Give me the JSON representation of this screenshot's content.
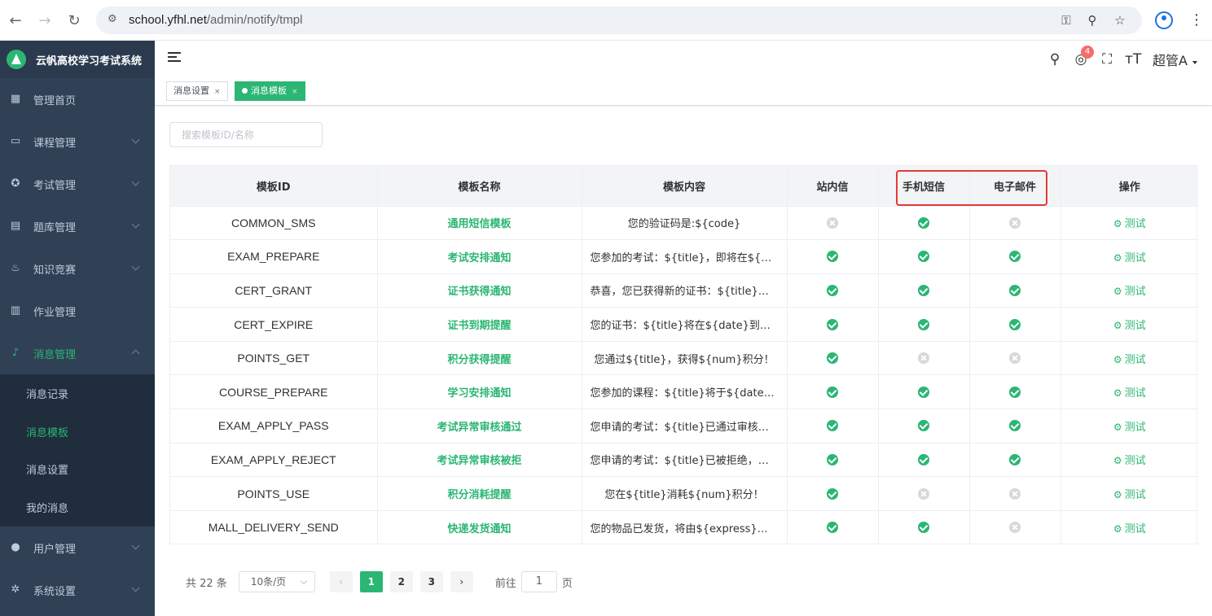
{
  "browser": {
    "url_host": "school.yfhl.net",
    "url_path": "/admin/notify/tmpl"
  },
  "sidebar": {
    "brand": "云帆高校学习考试系统",
    "items": [
      {
        "label": "管理首页",
        "icon": "dashboard-icon"
      },
      {
        "label": "课程管理",
        "icon": "monitor-icon"
      },
      {
        "label": "考试管理",
        "icon": "compass-icon"
      },
      {
        "label": "题库管理",
        "icon": "document-icon"
      },
      {
        "label": "知识竞赛",
        "icon": "fire-icon"
      },
      {
        "label": "作业管理",
        "icon": "book-icon"
      },
      {
        "label": "消息管理",
        "icon": "bell-icon"
      }
    ],
    "submenu": [
      {
        "label": "消息记录"
      },
      {
        "label": "消息模板"
      },
      {
        "label": "消息设置"
      },
      {
        "label": "我的消息"
      }
    ],
    "bottom_items": [
      {
        "label": "用户管理",
        "icon": "user-icon"
      },
      {
        "label": "系统设置",
        "icon": "gear-icon"
      }
    ]
  },
  "header": {
    "notification_count": "4",
    "user_name": "超管A"
  },
  "tags": [
    {
      "label": "消息设置"
    },
    {
      "label": "消息模板"
    }
  ],
  "search": {
    "placeholder": "搜索模板ID/名称"
  },
  "table": {
    "columns": [
      "模板ID",
      "模板名称",
      "模板内容",
      "站内信",
      "手机短信",
      "电子邮件",
      "操作"
    ],
    "action_label": "测试",
    "rows": [
      {
        "id": "COMMON_SMS",
        "name": "通用短信模板",
        "content": "您的验证码是:${code}",
        "site": false,
        "sms": true,
        "email": false
      },
      {
        "id": "EXAM_PREPARE",
        "name": "考试安排通知",
        "content": "您参加的考试：${title}，即将在${date}开始，请提前做好准备！",
        "site": true,
        "sms": true,
        "email": true
      },
      {
        "id": "CERT_GRANT",
        "name": "证书获得通知",
        "content": "恭喜，您已获得新的证书：${title}，请登录系统查看！",
        "site": true,
        "sms": true,
        "email": true
      },
      {
        "id": "CERT_EXPIRE",
        "name": "证书到期提醒",
        "content": "您的证书：${title}将在${date}到期，请及时处理！",
        "site": true,
        "sms": true,
        "email": true
      },
      {
        "id": "POINTS_GET",
        "name": "积分获得提醒",
        "content": "您通过${title}，获得${num}积分！",
        "site": true,
        "sms": false,
        "email": false
      },
      {
        "id": "COURSE_PREPARE",
        "name": "学习安排通知",
        "content": "您参加的课程：${title}将于${date}开始，请按时学习！",
        "site": true,
        "sms": true,
        "email": true
      },
      {
        "id": "EXAM_APPLY_PASS",
        "name": "考试异常审核通过",
        "content": "您申请的考试：${title}已通过审核，请按时参加考试！",
        "site": true,
        "sms": true,
        "email": true
      },
      {
        "id": "EXAM_APPLY_REJECT",
        "name": "考试异常审核被拒",
        "content": "您申请的考试：${title}已被拒绝，理由：${reason}",
        "site": true,
        "sms": true,
        "email": true
      },
      {
        "id": "POINTS_USE",
        "name": "积分消耗提醒",
        "content": "您在${title}消耗${num}积分！",
        "site": true,
        "sms": false,
        "email": false
      },
      {
        "id": "MALL_DELIVERY_SEND",
        "name": "快递发货通知",
        "content": "您的物品已发货，将由${express}护送，单号：${no}",
        "site": true,
        "sms": true,
        "email": false
      }
    ]
  },
  "pagination": {
    "total": "共 22 条",
    "page_size": "10条/页",
    "pages": [
      "1",
      "2",
      "3"
    ],
    "current": "1",
    "goto_prefix": "前往",
    "goto_value": "1",
    "goto_suffix": "页"
  },
  "colors": {
    "accent": "#2bb673",
    "sidebar_bg": "#304156",
    "highlight": "#e53935"
  }
}
